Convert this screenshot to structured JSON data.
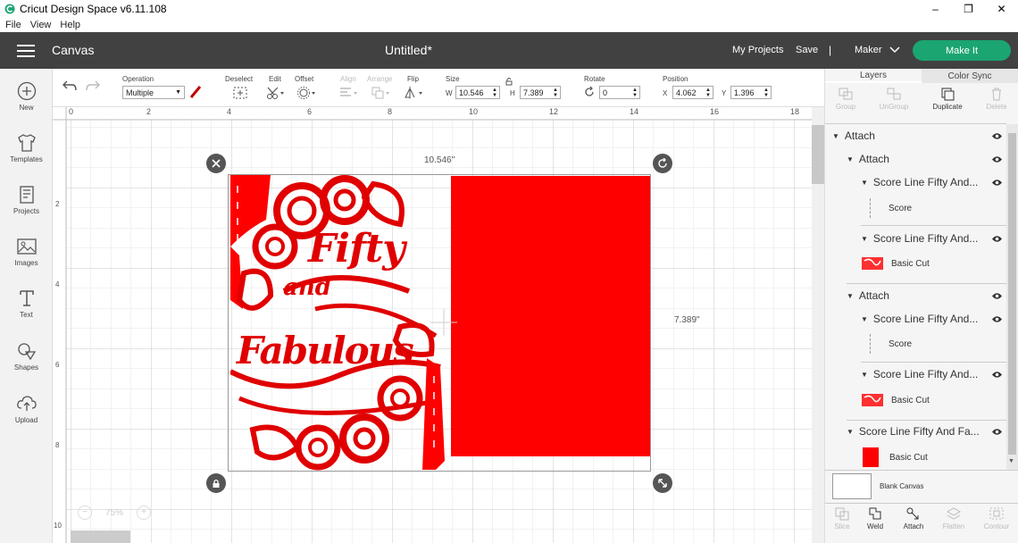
{
  "app": {
    "title": "Cricut Design Space  v6.11.108",
    "window_controls": [
      "–",
      "❐",
      "✕"
    ]
  },
  "menu": [
    "File",
    "View",
    "Help"
  ],
  "header": {
    "canvas_label": "Canvas",
    "doc_title": "Untitled*",
    "my_projects": "My Projects",
    "save": "Save",
    "separator": "|",
    "machine": "Maker",
    "make_it": "Make It"
  },
  "toolbar": {
    "operation_label": "Operation",
    "operation_value": "Multiple",
    "deselect_label": "Deselect",
    "edit_label": "Edit",
    "offset_label": "Offset",
    "align_label": "Align",
    "arrange_label": "Arrange",
    "flip_label": "Flip",
    "size_label": "Size",
    "w_label": "W",
    "w_value": "10.546",
    "h_label": "H",
    "h_value": "7.389",
    "rotate_label": "Rotate",
    "rotate_value": "0",
    "position_label": "Position",
    "x_label": "X",
    "x_value": "4.062",
    "y_label": "Y",
    "y_value": "1.396"
  },
  "leftnav": [
    {
      "label": "New",
      "icon": "plus-circle-icon"
    },
    {
      "label": "Templates",
      "icon": "shirt-icon"
    },
    {
      "label": "Projects",
      "icon": "projects-icon"
    },
    {
      "label": "Images",
      "icon": "image-icon"
    },
    {
      "label": "Text",
      "icon": "text-icon"
    },
    {
      "label": "Shapes",
      "icon": "shapes-icon"
    },
    {
      "label": "Upload",
      "icon": "upload-icon"
    }
  ],
  "canvas": {
    "ruler_top": [
      "0",
      "2",
      "4",
      "6",
      "8",
      "10",
      "12",
      "14",
      "16",
      "18"
    ],
    "ruler_left": [
      "2",
      "4",
      "6",
      "8",
      "10"
    ],
    "width_label": "10.546\"",
    "height_label": "7.389\"",
    "zoom": "75%",
    "design_text_1": "Fifty",
    "design_text_2": "and",
    "design_text_3": "Fabulous",
    "accent_color": "#ff0000"
  },
  "rightpanel": {
    "tabs": [
      "Layers",
      "Color Sync"
    ],
    "actions": [
      "Group",
      "UnGroup",
      "Duplicate",
      "Delete"
    ],
    "layers": [
      {
        "label": "Attach",
        "level": 0
      },
      {
        "label": "Attach",
        "level": 1
      },
      {
        "label": "Score Line Fifty And...",
        "level": 2
      },
      {
        "label": "Score",
        "level": 3
      },
      {
        "label": "Score Line Fifty And...",
        "level": 2
      },
      {
        "label": "Basic Cut",
        "level": 3
      },
      {
        "label": "Attach",
        "level": 1
      },
      {
        "label": "Score Line Fifty And...",
        "level": 2
      },
      {
        "label": "Score",
        "level": 3
      },
      {
        "label": "Score Line Fifty And...",
        "level": 2
      },
      {
        "label": "Basic Cut",
        "level": 3
      },
      {
        "label": "Score Line Fifty And Fa...",
        "level": 1
      },
      {
        "label": "Basic Cut",
        "level": 3
      }
    ],
    "blank_canvas": "Blank Canvas",
    "bottom_actions": [
      "Slice",
      "Weld",
      "Attach",
      "Flatten",
      "Contour"
    ]
  }
}
